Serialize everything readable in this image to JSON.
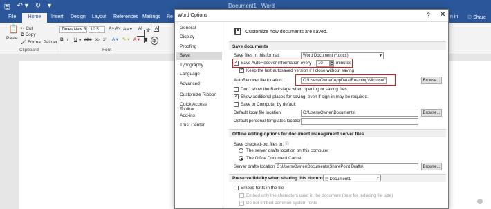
{
  "word": {
    "doc_title": "Document1 - Word",
    "qat": [
      "🖫",
      "↶ ▾",
      "↻",
      "▾"
    ],
    "tabs": [
      "File",
      "Home",
      "Insert",
      "Design",
      "Layout",
      "References",
      "Mailings",
      "Re"
    ],
    "signin": "n in",
    "share": "Share",
    "clipboard": {
      "paste": "Paste",
      "cut": "Cut",
      "copy": "Copy",
      "format_painter": "Format Painter",
      "group": "Clipboard"
    },
    "font": {
      "name": "Times New R",
      "size": "10.5",
      "bold": "B",
      "italic": "I",
      "underline": "U",
      "group": "Font",
      "strike": "abc",
      "sub": "x₂",
      "sup": "x²"
    }
  },
  "dialog": {
    "title": "Word Options",
    "help": "?",
    "close": "✕",
    "nav": [
      "General",
      "Display",
      "Proofing",
      "Save",
      "Typography",
      "Language",
      "Advanced",
      "Customize Ribbon",
      "Quick Access Toolbar",
      "Add-ins",
      "Trust Center"
    ],
    "selected_nav": "Save",
    "header": "Customize how documents are saved.",
    "save_documents": {
      "section": "Save documents",
      "format_label": "Save files in this format:",
      "format_value": "Word Document (*.docx)",
      "autorecover_label": "Save AutoRecover information every",
      "autorecover_value": "10",
      "minutes": "minutes",
      "keep_last": "Keep the last autosaved version if I close without saving",
      "location_label": "AutoRecover file location:",
      "location_value": "C:\\Users\\Owner\\AppData\\Roaming\\Microsoft\\Word\\",
      "browse": "Browse...",
      "no_backstage": "Don't show the Backstage when opening or saving files",
      "show_additional": "Show additional places for saving, even if sign-in may be required.",
      "save_computer": "Save to Computer by default",
      "default_local_label": "Default local file location:",
      "default_local_value": "C:\\Users\\Owner\\Documents\\",
      "default_templates_label": "Default personal templates location:",
      "default_templates_value": ""
    },
    "offline": {
      "section": "Offline editing options for document management server files",
      "checked_out_label": "Save checked-out files to:",
      "info": "ⓘ",
      "option1": "The server drafts location on this computer",
      "option2": "The Office Document Cache",
      "drafts_label": "Server drafts location:",
      "drafts_value": "C:\\Users\\Owner\\Documents\\SharePoint Drafts\\",
      "browse": "Browse..."
    },
    "fidelity": {
      "section": "Preserve fidelity when sharing this document:",
      "doc": "Document1",
      "embed_fonts": "Embed fonts in the file",
      "embed_used": "Embed only the characters used in the document (best for reducing file size)",
      "no_common": "Do not embed common system fonts"
    }
  }
}
